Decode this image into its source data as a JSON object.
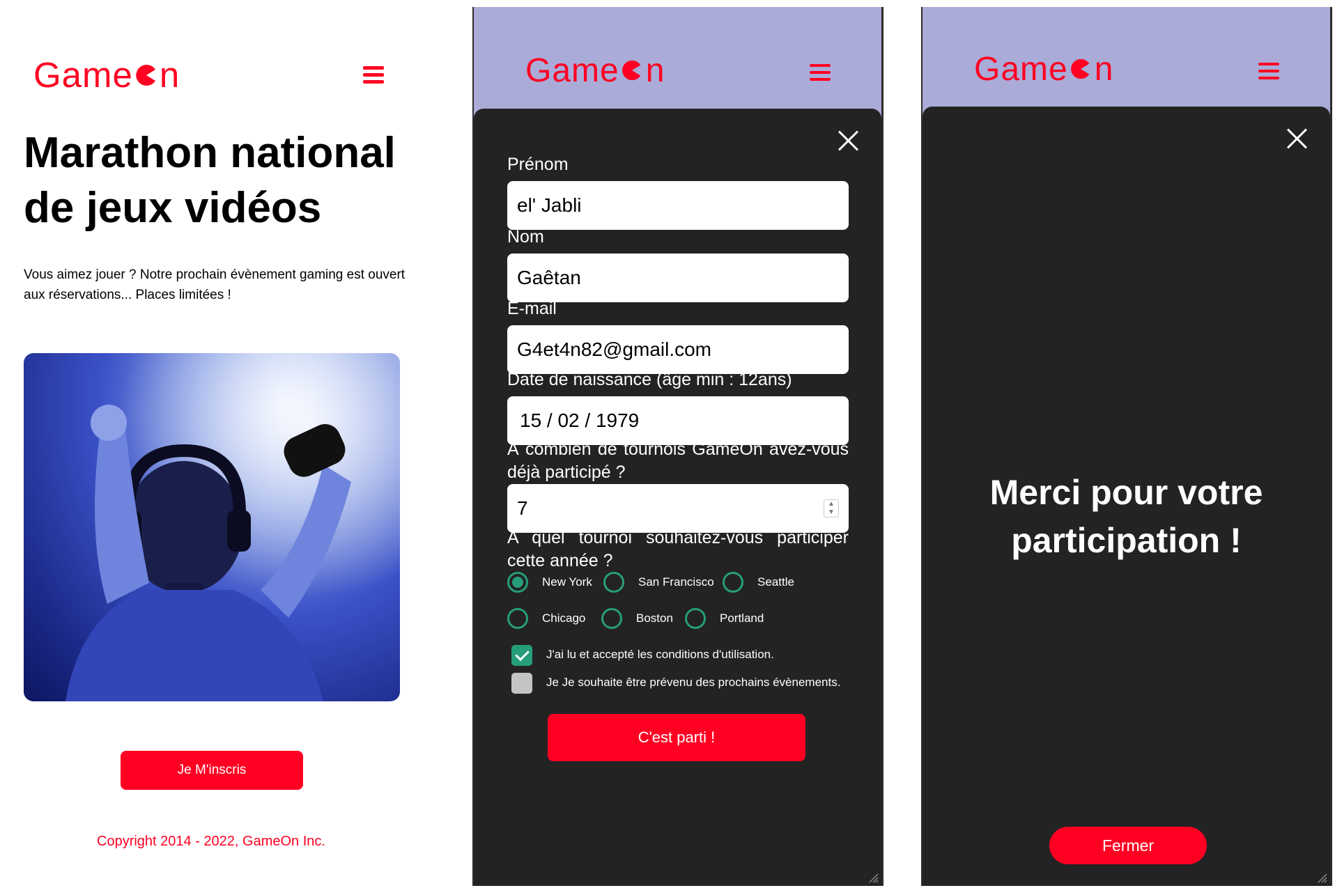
{
  "brand": {
    "logo_left": "Game",
    "logo_right": "n",
    "accent": "#ff0022",
    "success": "#279e7a"
  },
  "landing": {
    "title": "Marathon national de jeux vidéos",
    "text": "Vous aimez jouer ? Notre prochain évènement gaming est ouvert aux réservations... Places limitées !",
    "cta_label": "Je M'inscris",
    "copyright": "Copyright 2014 - 2022, GameOn Inc."
  },
  "form": {
    "firstname": {
      "label": "Prénom",
      "value": "el' Jabli"
    },
    "lastname": {
      "label": "Nom",
      "value": "Gaêtan"
    },
    "email": {
      "label": "E-mail",
      "value": "G4et4n82@gmail.com"
    },
    "birthdate": {
      "label": "Date de naissance (âge min : 12ans)",
      "value": "15 / 02 / 1979"
    },
    "quantity": {
      "label": "À combien de tournois GameOn avez-vous déjà participé ?",
      "value": "7"
    },
    "location_question": "A quel tournoi souhaitez-vous participer cette année ?",
    "locations": [
      {
        "label": "New York",
        "checked": true
      },
      {
        "label": "San Francisco",
        "checked": false
      },
      {
        "label": "Seattle",
        "checked": false
      },
      {
        "label": "Chicago",
        "checked": false
      },
      {
        "label": "Boston",
        "checked": false
      },
      {
        "label": "Portland",
        "checked": false
      }
    ],
    "terms": {
      "label": "J'ai lu et accepté les conditions d'utilisation.",
      "checked": true
    },
    "newsletter": {
      "label": "Je Je souhaite être prévenu des prochains évènements.",
      "checked": false
    },
    "submit_label": "C'est parti !"
  },
  "confirmation": {
    "message": "Merci pour votre participation !",
    "close_label": "Fermer"
  }
}
